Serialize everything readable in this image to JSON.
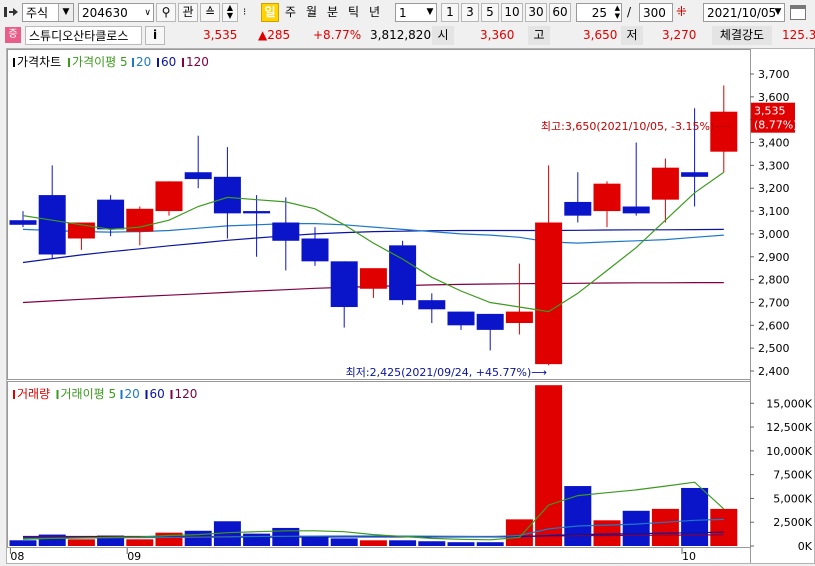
{
  "toolbar": {
    "market_select": "주식",
    "code": "204630",
    "btn_gwan": "관",
    "periods": [
      "일",
      "주",
      "월",
      "분",
      "틱",
      "년"
    ],
    "active_period": "일",
    "interval_value": "1",
    "quick_intervals": [
      "1",
      "3",
      "5",
      "10",
      "30",
      "60"
    ],
    "count": "25",
    "separator": "/",
    "total": "300",
    "date": "2021/10/05"
  },
  "quote": {
    "name": "스튜디오산타클로스",
    "info_btn": "i",
    "price": "3,535",
    "change": "▲285",
    "change_pct": "+8.77%",
    "volume": "3,812,820",
    "open_label": "시",
    "open": "3,360",
    "high_label": "고",
    "high": "3,650",
    "low_label": "저",
    "low": "3,270",
    "strength_label": "체결강도",
    "strength": "125.3"
  },
  "colors": {
    "up": "#e00000",
    "down": "#0a14c8",
    "ma5": "#3c9a1e",
    "ma20": "#1e78c8",
    "ma60": "#0a14a0",
    "ma120": "#800040"
  },
  "chart_data": [
    {
      "type": "candlestick",
      "legend": [
        {
          "name": "가격차트",
          "color": "#000000"
        },
        {
          "name": "가격이평 5",
          "color": "#3c9a1e"
        },
        {
          "name": "20",
          "color": "#1e78c8"
        },
        {
          "name": "60",
          "color": "#0a14a0"
        },
        {
          "name": "120",
          "color": "#800040"
        }
      ],
      "ylim": [
        2400,
        3700
      ],
      "y_ticks": [
        {
          "v": 3700,
          "t": "3,700"
        },
        {
          "v": 3600,
          "t": "3,600"
        },
        {
          "v": 3500,
          "t": "3,500"
        },
        {
          "v": 3400,
          "t": "3,400"
        },
        {
          "v": 3300,
          "t": "3,300"
        },
        {
          "v": 3200,
          "t": "3,200"
        },
        {
          "v": 3100,
          "t": "3,100"
        },
        {
          "v": 3000,
          "t": "3,000"
        },
        {
          "v": 2900,
          "t": "2,900"
        },
        {
          "v": 2800,
          "t": "2,800"
        },
        {
          "v": 2700,
          "t": "2,700"
        },
        {
          "v": 2600,
          "t": "2,600"
        },
        {
          "v": 2500,
          "t": "2,500"
        },
        {
          "v": 2400,
          "t": "2,400"
        }
      ],
      "candles": [
        {
          "o": 3060,
          "h": 3100,
          "l": 3030,
          "c": 3040
        },
        {
          "o": 3170,
          "h": 3300,
          "l": 2890,
          "c": 2910
        },
        {
          "o": 2980,
          "h": 3040,
          "l": 2930,
          "c": 3050
        },
        {
          "o": 3150,
          "h": 3170,
          "l": 2990,
          "c": 3020
        },
        {
          "o": 3010,
          "h": 3120,
          "l": 2950,
          "c": 3110
        },
        {
          "o": 3100,
          "h": 3230,
          "l": 3080,
          "c": 3230
        },
        {
          "o": 3270,
          "h": 3430,
          "l": 3200,
          "c": 3240
        },
        {
          "o": 3250,
          "h": 3380,
          "l": 2980,
          "c": 3090
        },
        {
          "o": 3100,
          "h": 3170,
          "l": 2900,
          "c": 3090
        },
        {
          "o": 3050,
          "h": 3160,
          "l": 2840,
          "c": 2970
        },
        {
          "o": 2980,
          "h": 3030,
          "l": 2860,
          "c": 2880
        },
        {
          "o": 2880,
          "h": 2880,
          "l": 2590,
          "c": 2680
        },
        {
          "o": 2760,
          "h": 2810,
          "l": 2720,
          "c": 2850
        },
        {
          "o": 2950,
          "h": 2970,
          "l": 2690,
          "c": 2710
        },
        {
          "o": 2710,
          "h": 2740,
          "l": 2610,
          "c": 2670
        },
        {
          "o": 2660,
          "h": 2660,
          "l": 2580,
          "c": 2600
        },
        {
          "o": 2650,
          "h": 2650,
          "l": 2490,
          "c": 2580
        },
        {
          "o": 2610,
          "h": 2870,
          "l": 2560,
          "c": 2660
        },
        {
          "o": 2430,
          "h": 3300,
          "l": 2425,
          "c": 3050
        },
        {
          "o": 3140,
          "h": 3270,
          "l": 3050,
          "c": 3080
        },
        {
          "o": 3100,
          "h": 3230,
          "l": 3030,
          "c": 3220
        },
        {
          "o": 3120,
          "h": 3400,
          "l": 3080,
          "c": 3090
        },
        {
          "o": 3150,
          "h": 3330,
          "l": 3050,
          "c": 3290
        },
        {
          "o": 3270,
          "h": 3550,
          "l": 3120,
          "c": 3250
        },
        {
          "o": 3360,
          "h": 3650,
          "l": 3270,
          "c": 3535
        }
      ],
      "ma5": [
        3080,
        3060,
        3040,
        3020,
        3030,
        3060,
        3120,
        3160,
        3150,
        3140,
        3110,
        3040,
        2960,
        2890,
        2810,
        2750,
        2700,
        2680,
        2660,
        2740,
        2840,
        2940,
        3060,
        3180,
        3270
      ],
      "ma20": [
        3020,
        3015,
        3010,
        3008,
        3010,
        3015,
        3025,
        3035,
        3040,
        3045,
        3045,
        3040,
        3030,
        3020,
        3010,
        3000,
        2995,
        2985,
        2965,
        2960,
        2965,
        2970,
        2975,
        2985,
        2995
      ],
      "ma60": [
        2875,
        2892,
        2908,
        2922,
        2935,
        2948,
        2960,
        2972,
        2982,
        2992,
        3000,
        3006,
        3010,
        3012,
        3014,
        3015,
        3015,
        3015,
        3015,
        3016,
        3017,
        3018,
        3018,
        3019,
        3020
      ],
      "ma120": [
        2700,
        2707,
        2714,
        2720,
        2726,
        2732,
        2738,
        2744,
        2750,
        2756,
        2762,
        2766,
        2770,
        2774,
        2777,
        2779,
        2781,
        2782,
        2783,
        2784,
        2785,
        2786,
        2786,
        2787,
        2787
      ],
      "annotations": {
        "high": "최고:3,650(2021/10/05, -3.15%)⟶",
        "low": "최저:2,425(2021/09/24, +45.77%)⟶",
        "last_price": "3,535",
        "last_pct": "(8.77%)"
      }
    },
    {
      "type": "bar",
      "legend": [
        {
          "name": "거래량",
          "color": "#e00000"
        },
        {
          "name": "거래이평 5",
          "color": "#3c9a1e"
        },
        {
          "name": "20",
          "color": "#1e78c8"
        },
        {
          "name": "60",
          "color": "#0a14a0"
        },
        {
          "name": "120",
          "color": "#800040"
        }
      ],
      "ylim": [
        0,
        16500
      ],
      "y_ticks": [
        {
          "v": 15000,
          "t": "15,000K"
        },
        {
          "v": 12500,
          "t": "12,500K"
        },
        {
          "v": 10000,
          "t": "10,000K"
        },
        {
          "v": 7500,
          "t": "7,500K"
        },
        {
          "v": 5000,
          "t": "5,000K"
        },
        {
          "v": 2500,
          "t": "2,500K"
        },
        {
          "v": 0,
          "t": "0K"
        }
      ],
      "values": [
        600,
        1200,
        700,
        1100,
        700,
        1400,
        1600,
        2600,
        1300,
        1900,
        900,
        800,
        600,
        600,
        500,
        400,
        400,
        2800,
        16900,
        6300,
        2700,
        3700,
        3900,
        6100,
        3900
      ],
      "vma5": [
        700,
        800,
        850,
        900,
        950,
        1100,
        1200,
        1400,
        1500,
        1600,
        1600,
        1500,
        1200,
        1000,
        800,
        700,
        650,
        900,
        4300,
        5300,
        5600,
        5900,
        6300,
        6700,
        3900
      ],
      "vma20": [
        800,
        820,
        840,
        860,
        880,
        900,
        930,
        960,
        1000,
        1020,
        1040,
        1050,
        1050,
        1040,
        1030,
        1000,
        980,
        1100,
        1800,
        2100,
        2200,
        2300,
        2500,
        2700,
        2800
      ],
      "vma60": [
        900,
        905,
        910,
        915,
        920,
        925,
        930,
        935,
        940,
        945,
        950,
        955,
        960,
        960,
        960,
        960,
        960,
        980,
        1100,
        1200,
        1250,
        1300,
        1350,
        1400,
        1450
      ],
      "vma120": [
        1000,
        1000,
        1000,
        1000,
        1000,
        1000,
        1000,
        1000,
        1000,
        1000,
        1000,
        1000,
        1000,
        1000,
        1000,
        1000,
        1000,
        1010,
        1050,
        1080,
        1100,
        1120,
        1140,
        1160,
        1180
      ],
      "x_labels": [
        {
          "i": 0,
          "t": "08"
        },
        {
          "i": 4,
          "t": "09"
        },
        {
          "i": 23,
          "t": "10"
        }
      ]
    }
  ]
}
